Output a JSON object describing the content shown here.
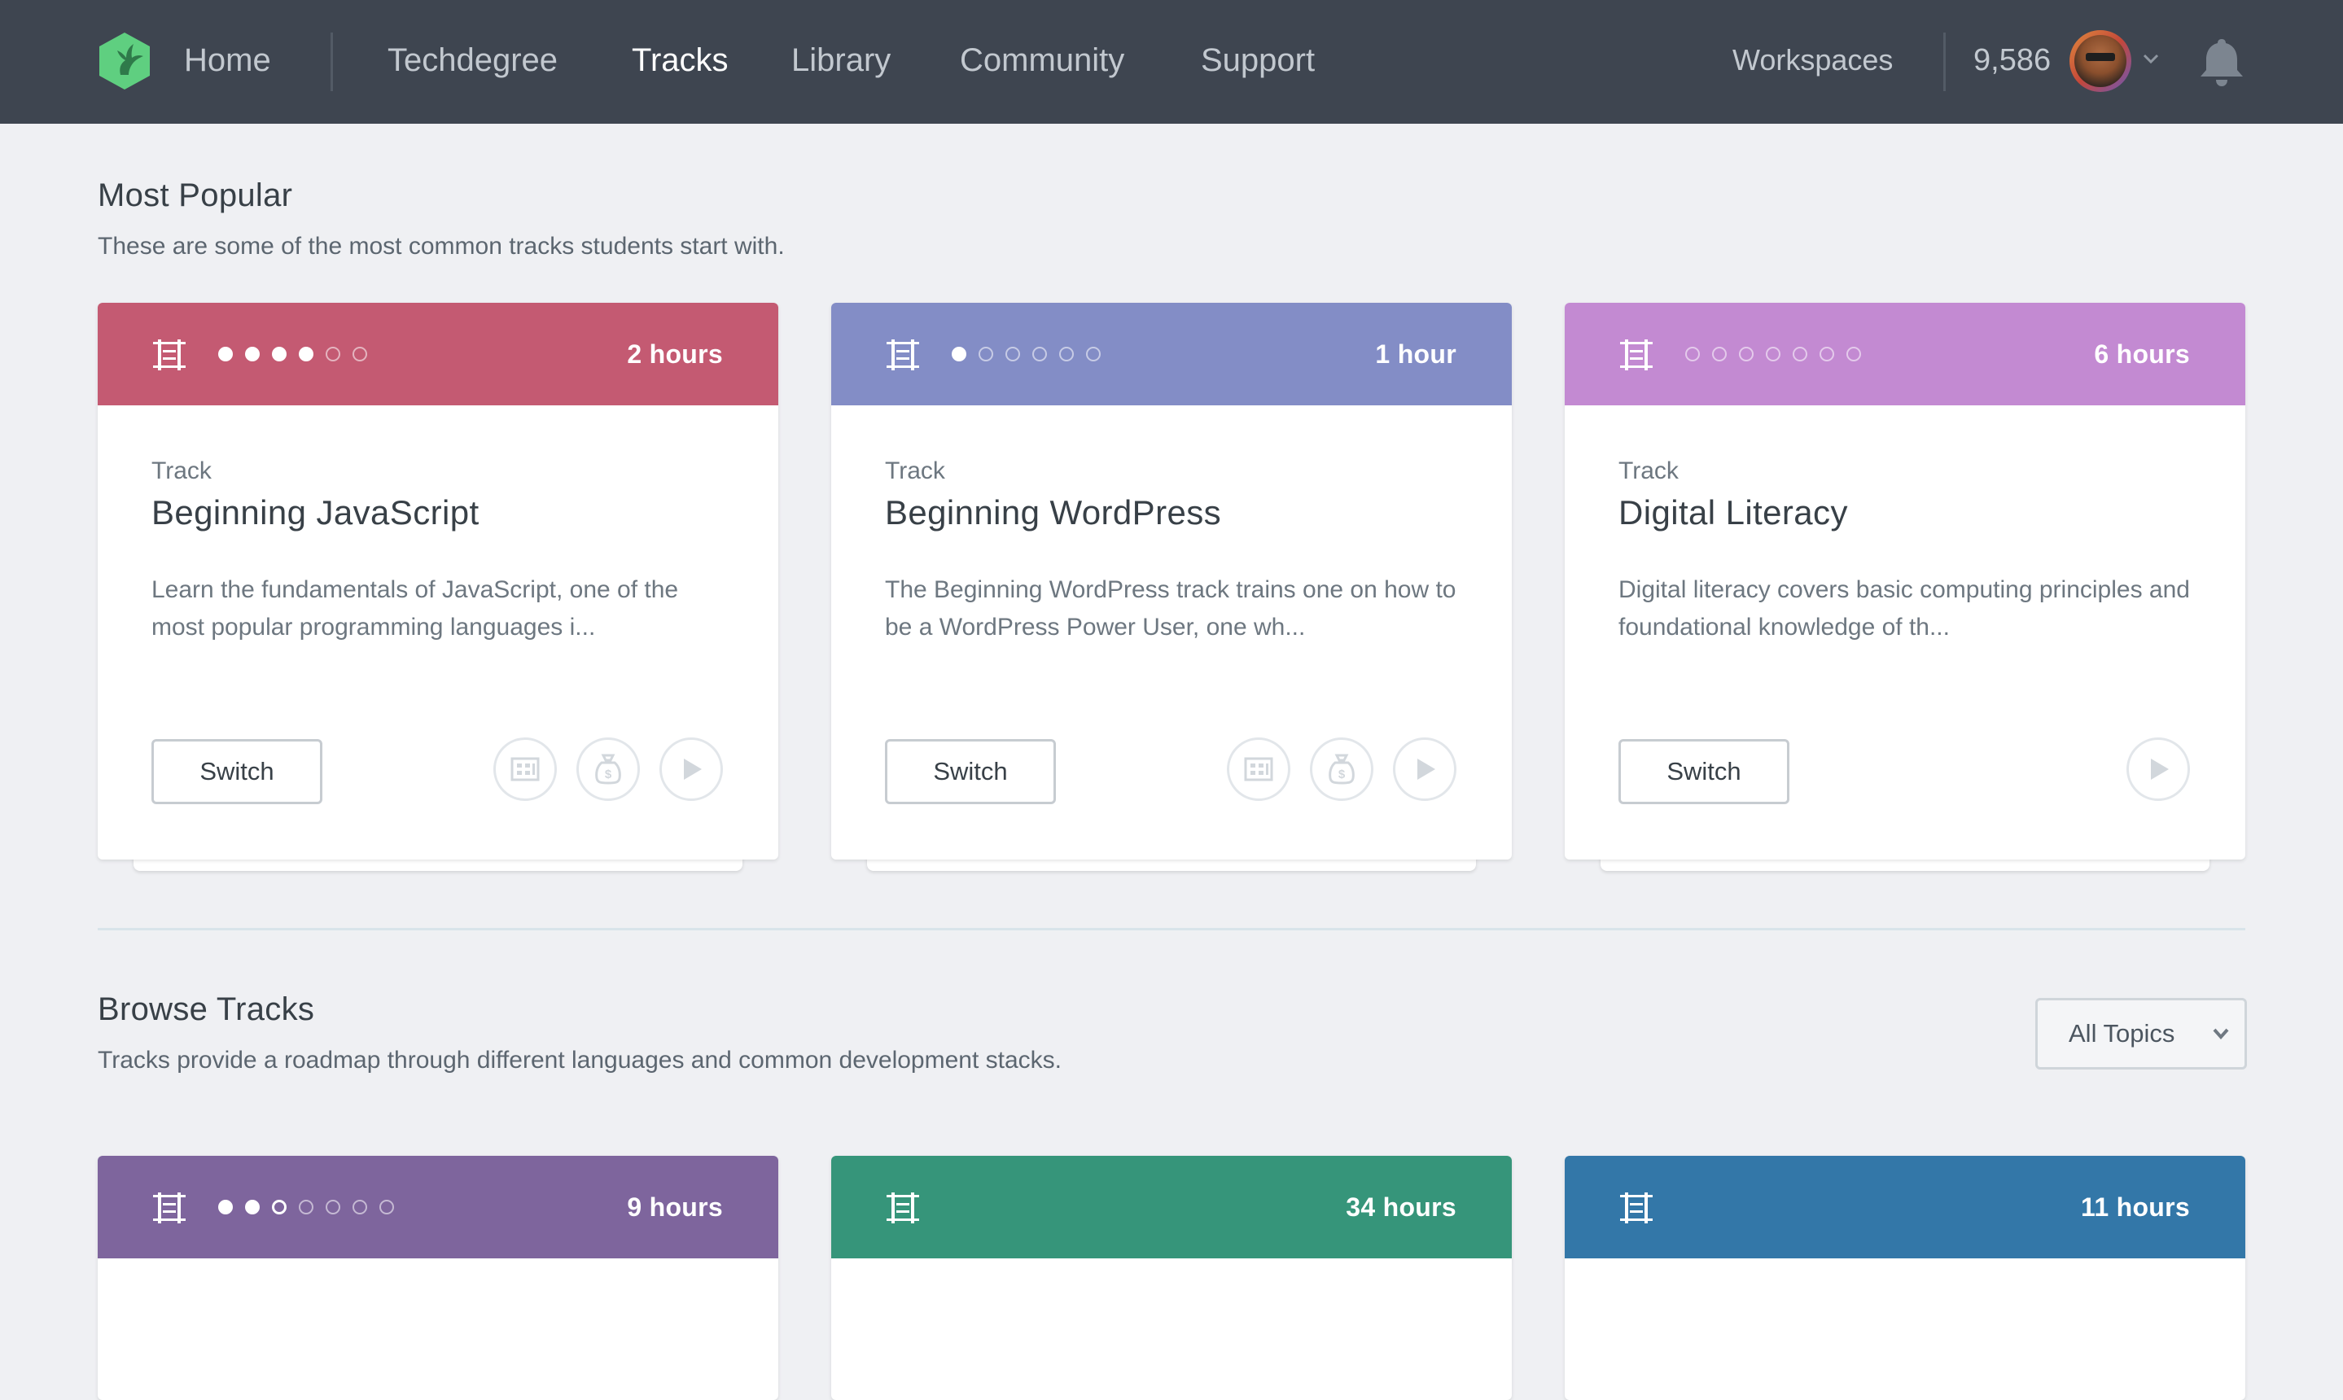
{
  "nav": {
    "links": [
      {
        "label": "Home"
      },
      {
        "label": "Techdegree"
      },
      {
        "label": "Tracks"
      },
      {
        "label": "Library"
      },
      {
        "label": "Community"
      },
      {
        "label": "Support"
      }
    ],
    "active": "Tracks",
    "workspaces": "Workspaces",
    "points": "9,586"
  },
  "most_popular": {
    "title": "Most Popular",
    "subtitle": "These are some of the most common tracks students start with."
  },
  "browse": {
    "title": "Browse Tracks",
    "subtitle": "Tracks provide a roadmap through different languages and common development stacks.",
    "filter_label": "All Topics"
  },
  "popular_cards": [
    {
      "color": "#c45a72",
      "dots_total": 6,
      "dots_filled": 4,
      "hours": "2 hours",
      "kind": "Track",
      "title": "Beginning JavaScript",
      "description": "Learn the fundamentals of JavaScript, one of the most popular programming languages i...",
      "button": "Switch",
      "icons": [
        "building-icon",
        "money-bag-icon",
        "play-icon"
      ]
    },
    {
      "color": "#838dc6",
      "dots_total": 6,
      "dots_filled": 1,
      "hours": "1 hour",
      "kind": "Track",
      "title": "Beginning WordPress",
      "description": "The Beginning WordPress track trains one on how to be a WordPress Power User, one wh...",
      "button": "Switch",
      "icons": [
        "building-icon",
        "money-bag-icon",
        "play-icon"
      ]
    },
    {
      "color": "#c38ad2",
      "dots_total": 7,
      "dots_filled": 0,
      "hours": "6 hours",
      "kind": "Track",
      "title": "Digital Literacy",
      "description": "Digital literacy covers basic computing principles and foundational knowledge of th...",
      "button": "Switch",
      "icons": [
        "play-icon"
      ]
    }
  ],
  "browse_cards": [
    {
      "color": "#7e659d",
      "dots_total": 7,
      "dots_filled": 2,
      "dots_current": 3,
      "hours": "9 hours"
    },
    {
      "color": "#36957a",
      "dots_total": 0,
      "dots_filled": 0,
      "hours": "34 hours"
    },
    {
      "color": "#3377a8",
      "dots_total": 0,
      "dots_filled": 0,
      "hours": "11 hours"
    }
  ]
}
